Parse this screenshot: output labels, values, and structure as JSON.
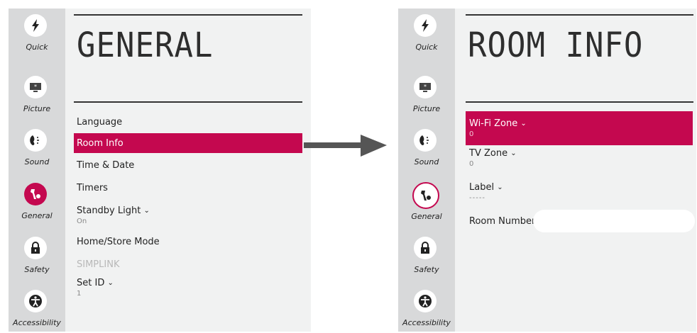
{
  "rail_items": [
    {
      "label": "Quick",
      "icon": "lightning-icon"
    },
    {
      "label": "Picture",
      "icon": "picture-icon"
    },
    {
      "label": "Sound",
      "icon": "sound-icon"
    },
    {
      "label": "General",
      "icon": "general-icon"
    },
    {
      "label": "Safety",
      "icon": "lock-icon"
    },
    {
      "label": "Accessibility",
      "icon": "accessibility-icon"
    }
  ],
  "left": {
    "title": "GENERAL",
    "menu": [
      {
        "label": "Language"
      },
      {
        "label": "Room Info"
      },
      {
        "label": "Time & Date"
      },
      {
        "label": "Timers"
      },
      {
        "label": "Standby Light",
        "value": "On"
      },
      {
        "label": "Home/Store Mode"
      },
      {
        "label": "SIMPLINK"
      },
      {
        "label": "Set ID",
        "value": "1"
      }
    ]
  },
  "right": {
    "title": "ROOM INFO",
    "menu": [
      {
        "label": "Wi-Fi Zone",
        "value": "0"
      },
      {
        "label": "TV Zone",
        "value": "0"
      },
      {
        "label": "Label",
        "value": "-----"
      },
      {
        "label": "Room Number",
        "value": ""
      }
    ]
  },
  "chevron": "⌄",
  "colors": {
    "accent": "#c4084f",
    "rail": "#d8d9da",
    "panel": "#f1f2f2",
    "arrow": "#555555"
  }
}
